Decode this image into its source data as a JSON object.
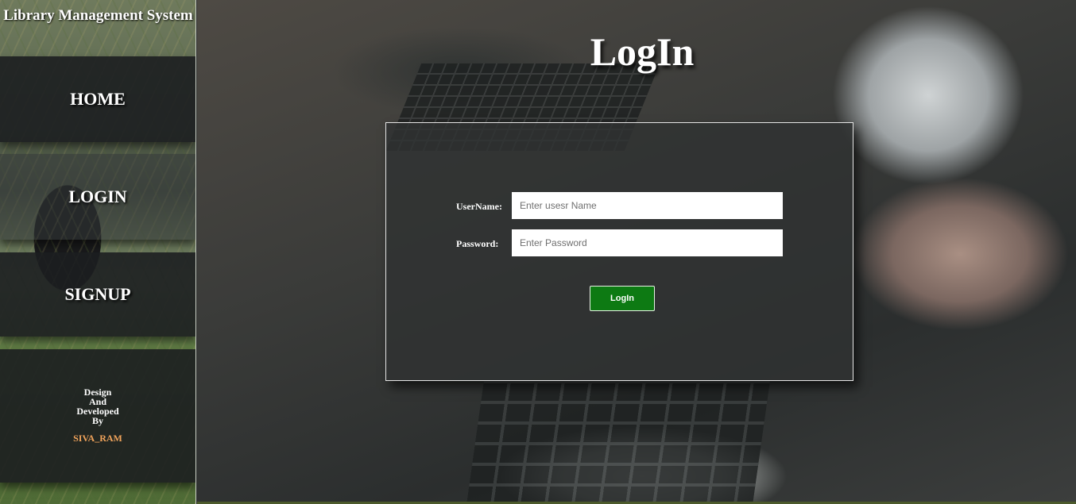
{
  "sidebar": {
    "brand": "Library Management System",
    "items": [
      {
        "label": "HOME"
      },
      {
        "label": "LOGIN"
      },
      {
        "label": "SIGNUP"
      }
    ],
    "credits": {
      "lines": [
        "Design",
        "And",
        "Developed",
        "By"
      ],
      "author": "SIVA_RAM"
    }
  },
  "main": {
    "title": "LogIn",
    "form": {
      "username_label": "UserName:",
      "username_placeholder": "Enter usesr Name",
      "password_label": "Password:",
      "password_placeholder": "Enter Password",
      "submit_label": "LogIn"
    }
  },
  "colors": {
    "button": "#0d7a13",
    "author": "#f0a35b"
  }
}
